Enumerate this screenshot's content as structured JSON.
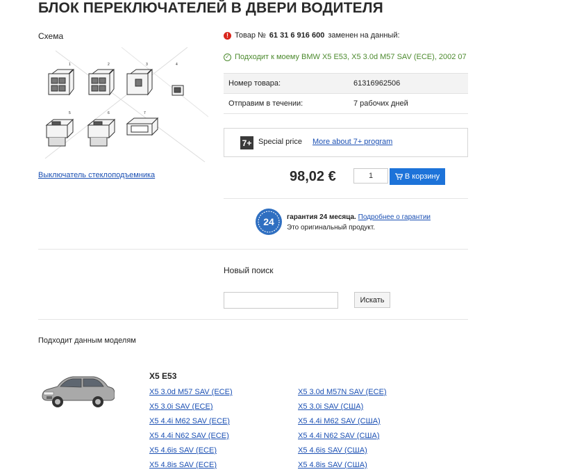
{
  "page": {
    "title": "БЛОК ПЕРЕКЛЮЧАТЕЛЕЙ В ДВЕРИ ВОДИТЕЛЯ"
  },
  "scheme": {
    "label": "Схема",
    "link": "Выключатель стеклоподъемника",
    "part_numbers": [
      "1",
      "2",
      "3",
      "4",
      "5",
      "6",
      "7"
    ]
  },
  "notices": {
    "replaced_prefix": "Товар №",
    "replaced_number": "61 31 6 916 600",
    "replaced_suffix": "заменен на данный:",
    "fits": "Подходит к моему BMW X5 E53, X5 3.0d M57 SAV (ECE), 2002 07"
  },
  "info": {
    "rows": [
      {
        "label": "Номер товара:",
        "value": "61316962506"
      },
      {
        "label": "Отправим в течении:",
        "value": "7 рабочих дней"
      }
    ]
  },
  "special": {
    "icon": "7+",
    "label": "Special price",
    "link": "More about 7+ program"
  },
  "purchase": {
    "price": "98,02 €",
    "quantity": "1",
    "cart_button": "В корзину"
  },
  "warranty": {
    "badge": "24",
    "bold": "гарантия 24 месяца.",
    "link": "Подробнее о гарантии",
    "original": "Это оригинальный продукт."
  },
  "search": {
    "label": "Новый поиск",
    "value": "",
    "button": "Искать"
  },
  "models": {
    "label": "Подходит данным моделям",
    "series": "X5 E53",
    "left": [
      "X5 3.0d M57 SAV (ECE)",
      "X5 3.0i SAV (ECE)",
      "X5 4.4i M62 SAV (ECE)",
      "X5 4.4i N62 SAV (ECE)",
      "X5 4.6is SAV (ECE)",
      "X5 4.8is SAV (ECE)"
    ],
    "right": [
      "X5 3.0d M57N SAV (ECE)",
      "X5 3.0i SAV (США)",
      "X5 4.4i M62 SAV (США)",
      "X5 4.4i N62 SAV (США)",
      "X5 4.6is SAV (США)",
      "X5 4.8is SAV (США)"
    ]
  },
  "colors": {
    "link": "#1a4fb3",
    "cart_button": "#1d73d9",
    "ok_green": "#4c8a2e",
    "error_red": "#d9261c"
  }
}
